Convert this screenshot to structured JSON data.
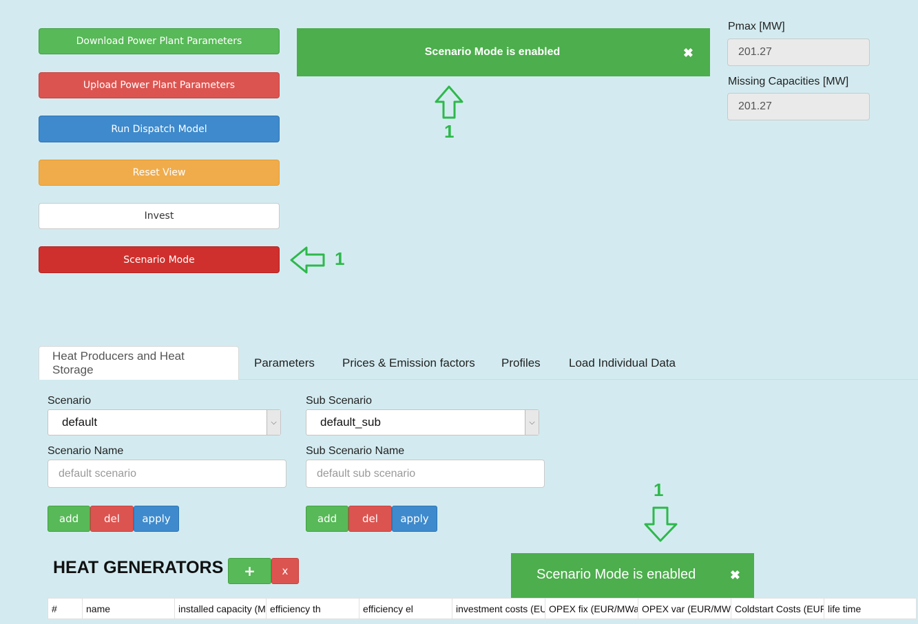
{
  "actions": {
    "download": "Download Power Plant Parameters",
    "upload": "Upload Power Plant Parameters",
    "run": "Run Dispatch Model",
    "reset": "Reset View",
    "invest": "Invest",
    "scenario_mode": "Scenario Mode"
  },
  "banner_top": {
    "text": "Scenario Mode is enabled",
    "close": "✖"
  },
  "banner_bottom": {
    "text": "Scenario Mode is enabled",
    "close": "✖"
  },
  "stats": {
    "pmax_label": "Pmax [MW]",
    "pmax_value": "201.27",
    "missing_label": "Missing Capacities [MW]",
    "missing_value": "201.27"
  },
  "annotations": {
    "label": "1",
    "color": "#2eb84b"
  },
  "tabs": [
    "Heat Producers and Heat Storage",
    "Parameters",
    "Prices & Emission factors",
    "Profiles",
    "Load Individual Data"
  ],
  "scenario": {
    "label": "Scenario",
    "value": "default",
    "name_label": "Scenario Name",
    "name_placeholder": "default scenario",
    "add": "add",
    "del": "del",
    "apply": "apply"
  },
  "sub_scenario": {
    "label": "Sub Scenario",
    "value": "default_sub",
    "name_label": "Sub Scenario Name",
    "name_placeholder": "default sub scenario",
    "add": "add",
    "del": "del",
    "apply": "apply"
  },
  "generators": {
    "title": "HEAT GENERATORS",
    "add": "+",
    "remove": "x",
    "columns": [
      "#",
      "name",
      "installed capacity (M",
      "efficiency th",
      "efficiency el",
      "investment costs (EU",
      "OPEX fix (EUR/MWa)",
      "OPEX var (EUR/MWh",
      "Coldstart Costs (EUR",
      "life time"
    ]
  }
}
